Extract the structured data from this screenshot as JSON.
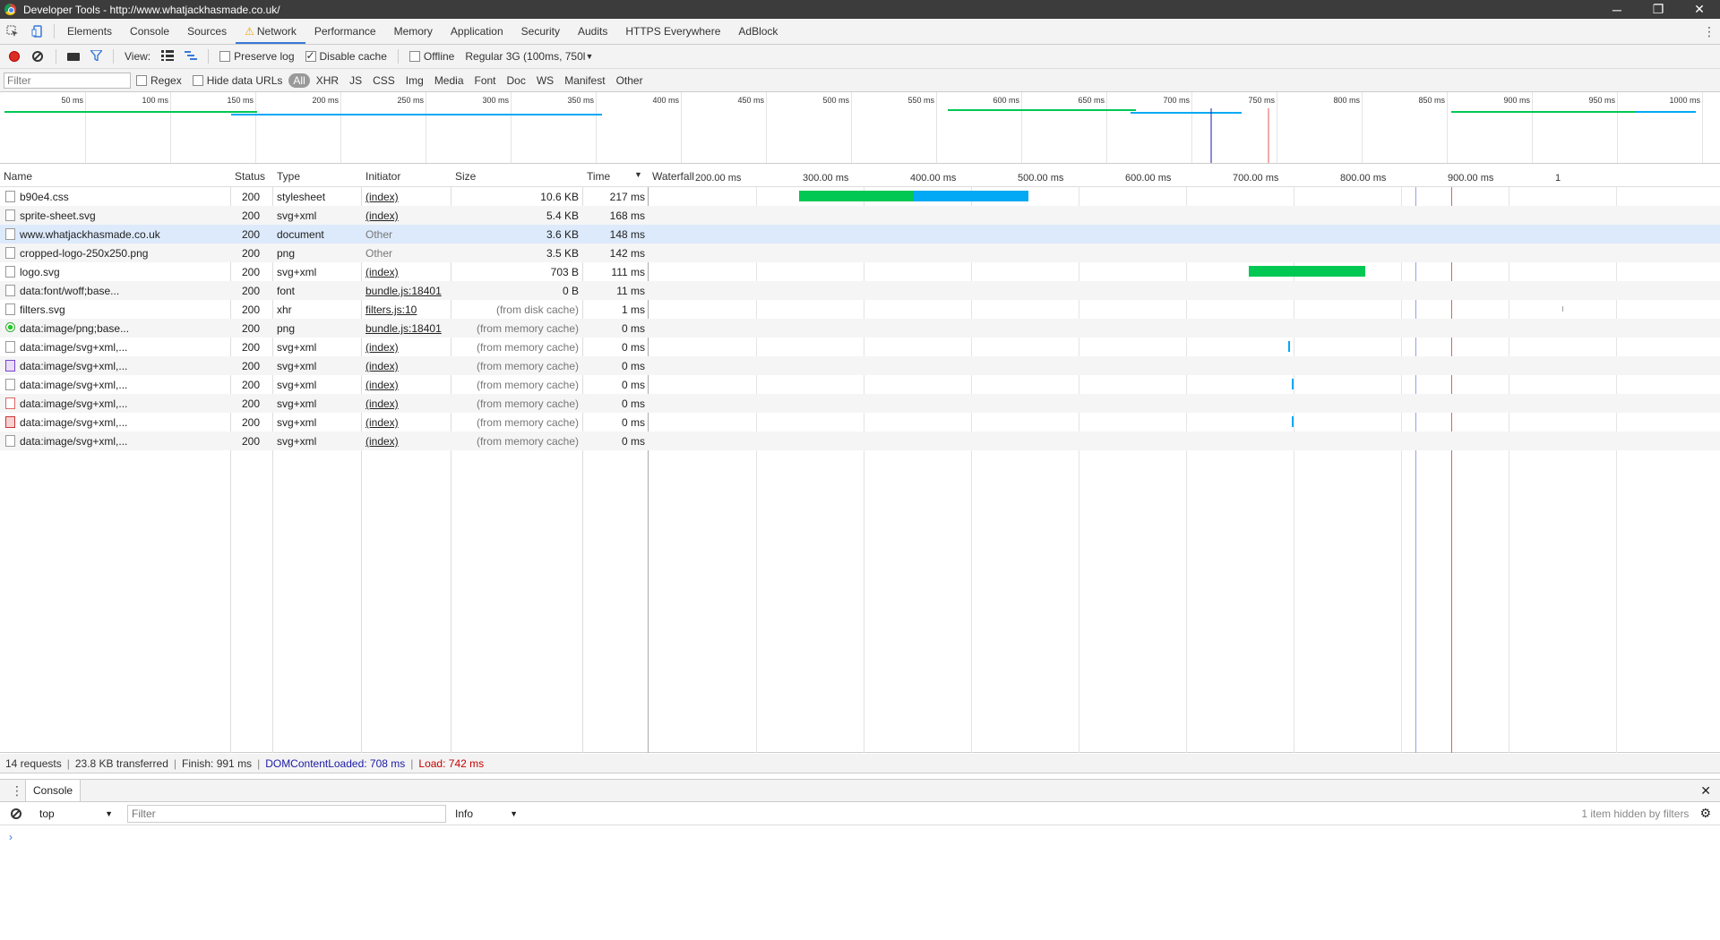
{
  "window": {
    "title": "Developer Tools - http://www.whatjackhasmade.co.uk/",
    "minimize": "─",
    "maximize": "❐",
    "close": "✕"
  },
  "tabs": [
    "Elements",
    "Console",
    "Sources",
    "Network",
    "Performance",
    "Memory",
    "Application",
    "Security",
    "Audits",
    "HTTPS Everywhere",
    "AdBlock"
  ],
  "active_tab": "Network",
  "toolbar": {
    "view_label": "View:",
    "preserve_log": "Preserve log",
    "disable_cache": "Disable cache",
    "offline": "Offline",
    "throttle": "Regular 3G (100ms, 750l"
  },
  "filterbar": {
    "placeholder": "Filter",
    "regex": "Regex",
    "hide_data_urls": "Hide data URLs",
    "types": [
      "All",
      "XHR",
      "JS",
      "CSS",
      "Img",
      "Media",
      "Font",
      "Doc",
      "WS",
      "Manifest",
      "Other"
    ]
  },
  "overview_ticks": [
    "50 ms",
    "100 ms",
    "150 ms",
    "200 ms",
    "250 ms",
    "300 ms",
    "350 ms",
    "400 ms",
    "450 ms",
    "500 ms",
    "550 ms",
    "600 ms",
    "650 ms",
    "700 ms",
    "750 ms",
    "800 ms",
    "850 ms",
    "900 ms",
    "950 ms",
    "1000 ms"
  ],
  "columns": {
    "name": "Name",
    "status": "Status",
    "type": "Type",
    "initiator": "Initiator",
    "size": "Size",
    "time": "Time",
    "waterfall": "Waterfall"
  },
  "waterfall_ticks": [
    "200.00 ms",
    "300.00 ms",
    "400.00 ms",
    "500.00 ms",
    "600.00 ms",
    "700.00 ms",
    "800.00 ms",
    "900.00 ms",
    "1"
  ],
  "requests": [
    {
      "name": "b90e4.css",
      "status": "200",
      "type": "stylesheet",
      "initiator": "(index)",
      "size": "10.6 KB",
      "time": "217 ms",
      "icon": "file"
    },
    {
      "name": "sprite-sheet.svg",
      "status": "200",
      "type": "svg+xml",
      "initiator": "(index)",
      "size": "5.4 KB",
      "time": "168 ms",
      "icon": "file"
    },
    {
      "name": "www.whatjackhasmade.co.uk",
      "status": "200",
      "type": "document",
      "initiator": "Other",
      "size": "3.6 KB",
      "time": "148 ms",
      "icon": "file"
    },
    {
      "name": "cropped-logo-250x250.png",
      "status": "200",
      "type": "png",
      "initiator": "Other",
      "size": "3.5 KB",
      "time": "142 ms",
      "icon": "file"
    },
    {
      "name": "logo.svg",
      "status": "200",
      "type": "svg+xml",
      "initiator": "(index)",
      "size": "703 B",
      "time": "111 ms",
      "icon": "file"
    },
    {
      "name": "data:font/woff;base...",
      "status": "200",
      "type": "font",
      "initiator": "bundle.js:18401",
      "size": "0 B",
      "time": "11 ms",
      "icon": "file"
    },
    {
      "name": "filters.svg",
      "status": "200",
      "type": "xhr",
      "initiator": "filters.js:10",
      "size": "(from disk cache)",
      "time": "1 ms",
      "icon": "file"
    },
    {
      "name": "data:image/png;base...",
      "status": "200",
      "type": "png",
      "initiator": "bundle.js:18401",
      "size": "(from memory cache)",
      "time": "0 ms",
      "icon": "green"
    },
    {
      "name": "data:image/svg+xml,...",
      "status": "200",
      "type": "svg+xml",
      "initiator": "(index)",
      "size": "(from memory cache)",
      "time": "0 ms",
      "icon": "file"
    },
    {
      "name": "data:image/svg+xml,...",
      "status": "200",
      "type": "svg+xml",
      "initiator": "(index)",
      "size": "(from memory cache)",
      "time": "0 ms",
      "icon": "purple"
    },
    {
      "name": "data:image/svg+xml,...",
      "status": "200",
      "type": "svg+xml",
      "initiator": "(index)",
      "size": "(from memory cache)",
      "time": "0 ms",
      "icon": "file"
    },
    {
      "name": "data:image/svg+xml,...",
      "status": "200",
      "type": "svg+xml",
      "initiator": "(index)",
      "size": "(from memory cache)",
      "time": "0 ms",
      "icon": "pink"
    },
    {
      "name": "data:image/svg+xml,...",
      "status": "200",
      "type": "svg+xml",
      "initiator": "(index)",
      "size": "(from memory cache)",
      "time": "0 ms",
      "icon": "red"
    },
    {
      "name": "data:image/svg+xml,...",
      "status": "200",
      "type": "svg+xml",
      "initiator": "(index)",
      "size": "(from memory cache)",
      "time": "0 ms",
      "icon": "file"
    }
  ],
  "selected_row": 2,
  "status": {
    "requests": "14 requests",
    "transferred": "23.8 KB transferred",
    "finish": "Finish: 991 ms",
    "dcl": "DOMContentLoaded: 708 ms",
    "load": "Load: 742 ms"
  },
  "drawer": {
    "tab": "Console",
    "context": "top",
    "filter_placeholder": "Filter",
    "level": "Info",
    "hidden_note": "1 item hidden by filters",
    "prompt": "›"
  },
  "colors": {
    "waiting": "#00c853",
    "download": "#03a9f4",
    "dcl_line": "#1a1aa6",
    "load_line": "#c80000",
    "accent": "#3879d9"
  }
}
